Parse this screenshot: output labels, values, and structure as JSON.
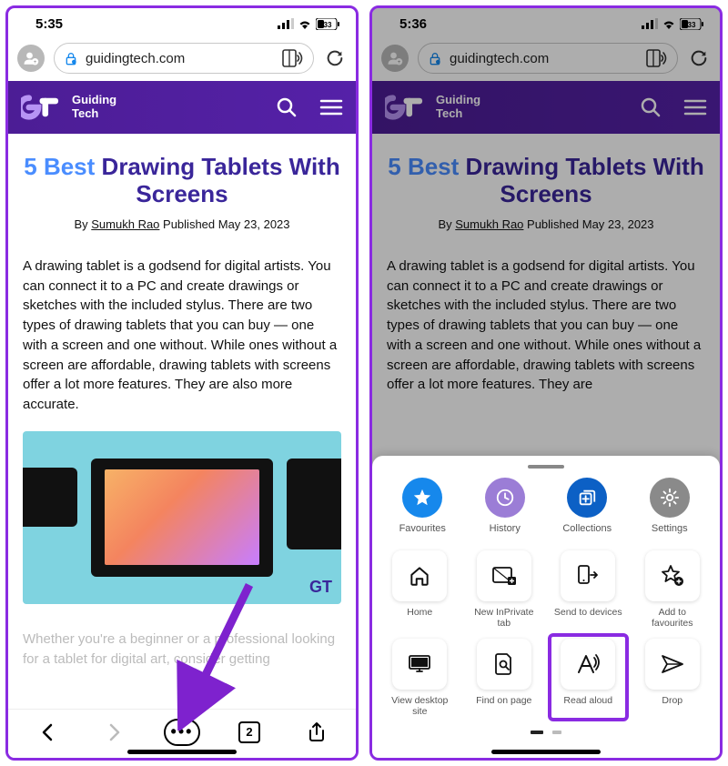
{
  "left": {
    "status": {
      "time": "5:35",
      "battery": "33"
    },
    "urlbar": {
      "domain": "guidingtech.com"
    },
    "site": {
      "name_line1": "Guiding",
      "name_line2": "Tech"
    },
    "article": {
      "title_accent": "5 Best",
      "title_rest": " Drawing Tablets With Screens",
      "byline_by": "By ",
      "byline_author": "Sumukh Rao",
      "byline_published": "  Published May 23, 2023",
      "body": "A drawing tablet is a godsend for digital artists. You can connect it to a PC and create drawings or sketches with the included stylus. There are two types of drawing tablets that you can buy — one with a screen and one without. While ones without a screen are affordable, drawing tablets with screens offer a lot more features. They are also more accurate.",
      "hero_logo": "GT",
      "faded": "Whether you're a beginner or a professional looking for a tablet for digital art, consider getting"
    },
    "toolbar": {
      "tab_count": "2"
    }
  },
  "right": {
    "status": {
      "time": "5:36",
      "battery": "33"
    },
    "urlbar": {
      "domain": "guidingtech.com"
    },
    "site": {
      "name_line1": "Guiding",
      "name_line2": "Tech"
    },
    "article": {
      "title_accent": "5 Best",
      "title_rest": " Drawing Tablets With Screens",
      "byline_by": "By ",
      "byline_author": "Sumukh Rao",
      "byline_published": "  Published May 23, 2023",
      "body": "A drawing tablet is a godsend for digital artists. You can connect it to a PC and create drawings or sketches with the included stylus. There are two types of drawing tablets that you can buy — one with a screen and one without. While ones without a screen are affordable, drawing tablets with screens offer a lot more features. They are"
    },
    "sheet": {
      "row1": {
        "favourites": "Favourites",
        "history": "History",
        "collections": "Collections",
        "settings": "Settings"
      },
      "grid": {
        "home": "Home",
        "new_inprivate": "New InPrivate tab",
        "send_devices": "Send to devices",
        "add_fav": "Add to favourites",
        "desktop_site": "View desktop site",
        "find_page": "Find on page",
        "read_aloud": "Read aloud",
        "drop": "Drop"
      }
    }
  }
}
